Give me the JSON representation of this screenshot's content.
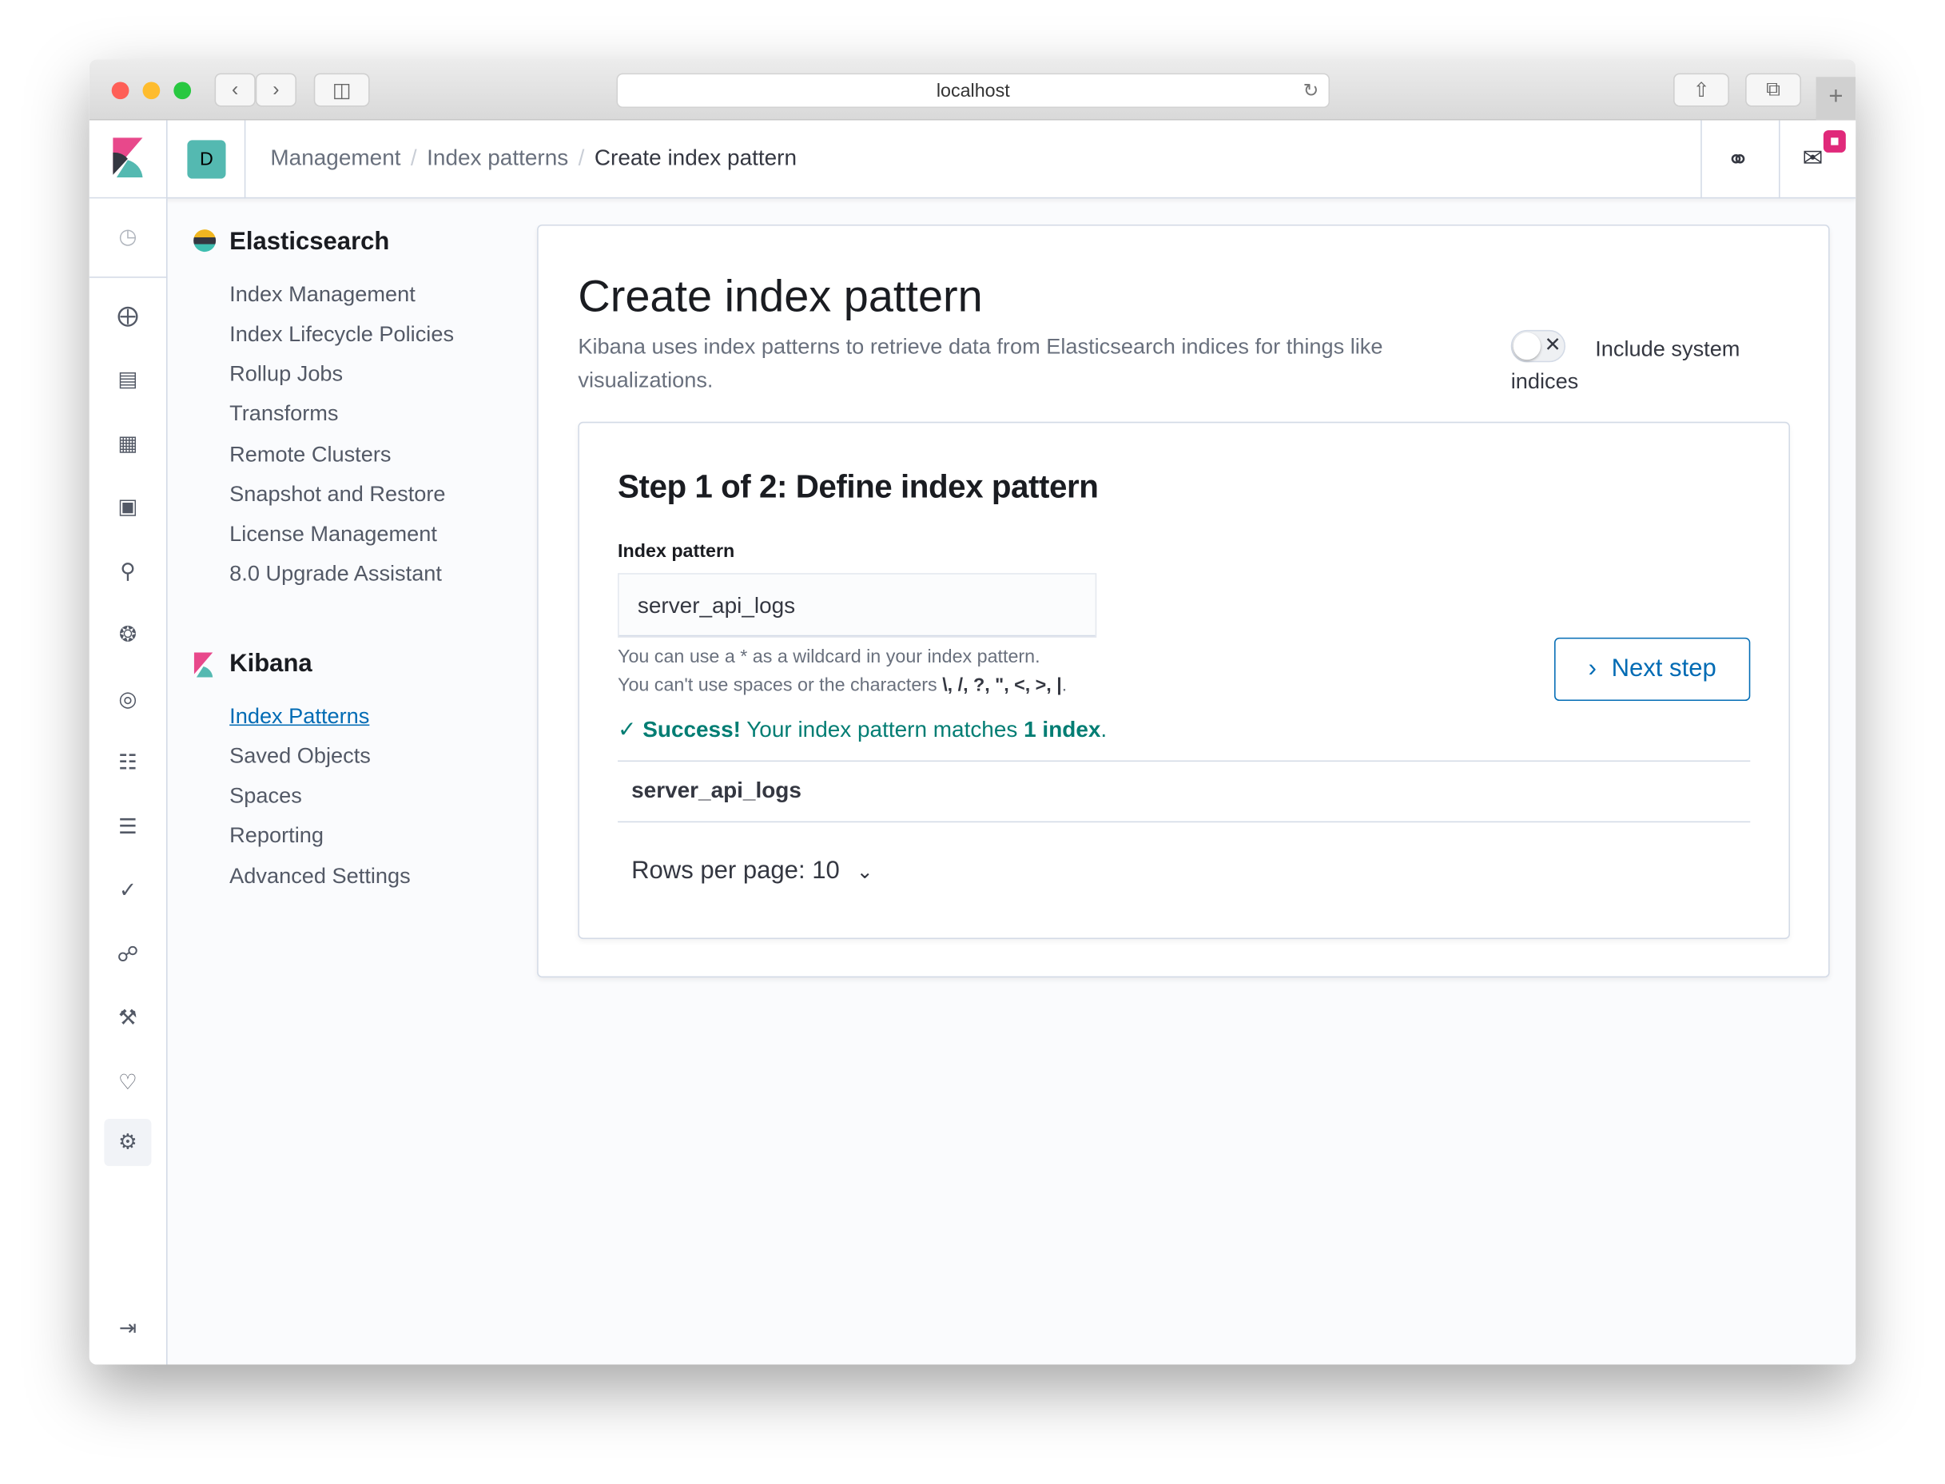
{
  "browser": {
    "url": "localhost"
  },
  "header": {
    "avatar": "D",
    "breadcrumbs": [
      "Management",
      "Index patterns",
      "Create index pattern"
    ]
  },
  "sidebar": {
    "sections": [
      {
        "title": "Elasticsearch",
        "items": [
          "Index Management",
          "Index Lifecycle Policies",
          "Rollup Jobs",
          "Transforms",
          "Remote Clusters",
          "Snapshot and Restore",
          "License Management",
          "8.0 Upgrade Assistant"
        ]
      },
      {
        "title": "Kibana",
        "items": [
          "Index Patterns",
          "Saved Objects",
          "Spaces",
          "Reporting",
          "Advanced Settings"
        ],
        "active": "Index Patterns"
      }
    ]
  },
  "main": {
    "title": "Create index pattern",
    "description": "Kibana uses index patterns to retrieve data from Elasticsearch indices for things like visualizations.",
    "toggle": {
      "label": "Include system indices",
      "on": false
    },
    "step_title": "Step 1 of 2: Define index pattern",
    "field_label": "Index pattern",
    "field_value": "server_api_logs",
    "help1": "You can use a * as a wildcard in your index pattern.",
    "help2_prefix": "You can't use spaces or the characters ",
    "help2_chars": "\\, /, ?, \", <, >, |",
    "help2_suffix": ".",
    "success_bold": "Success!",
    "success_text": " Your index pattern matches ",
    "success_count": "1 index",
    "success_end": ".",
    "next_label": "Next step",
    "results": [
      "server_api_logs"
    ],
    "rows_per_page": "Rows per page: 10"
  },
  "colors": {
    "accent": "#006bb4",
    "success": "#017d73",
    "teal": "#54b9b1",
    "badge": "#e0297a"
  }
}
